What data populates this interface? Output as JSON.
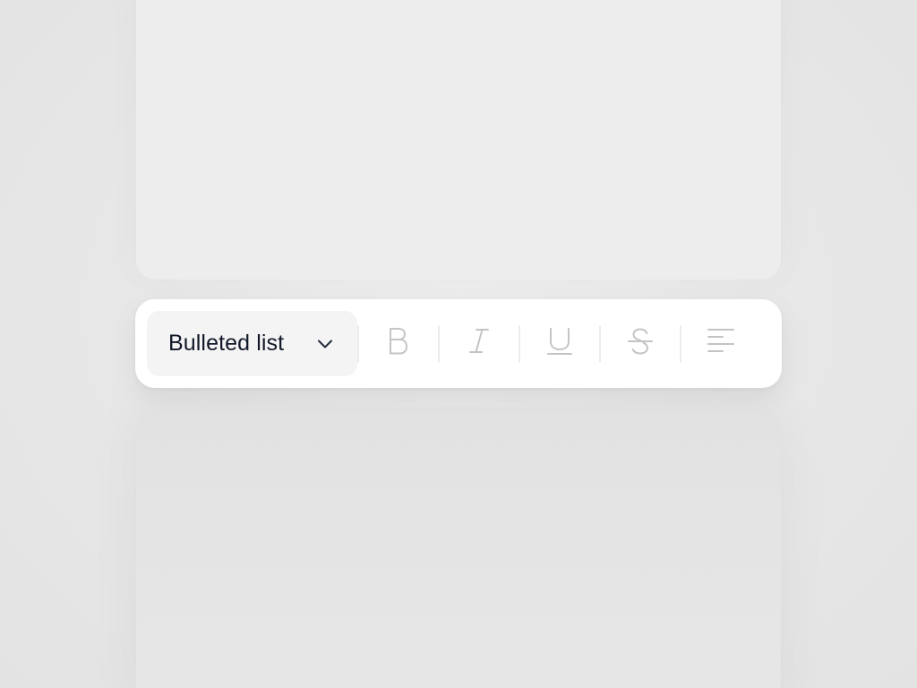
{
  "toolbar": {
    "block_type_label": "Bulleted list",
    "icons": {
      "dropdown": "chevron-down-icon",
      "bold": "bold-icon",
      "italic": "italic-icon",
      "underline": "underline-icon",
      "strikethrough": "strikethrough-icon",
      "align": "align-left-icon"
    }
  },
  "colors": {
    "toolbar_bg": "#ffffff",
    "select_bg": "#f4f4f5",
    "label_text": "#111827",
    "disabled_icon": "#c4c4c4",
    "separator": "#ececec"
  }
}
